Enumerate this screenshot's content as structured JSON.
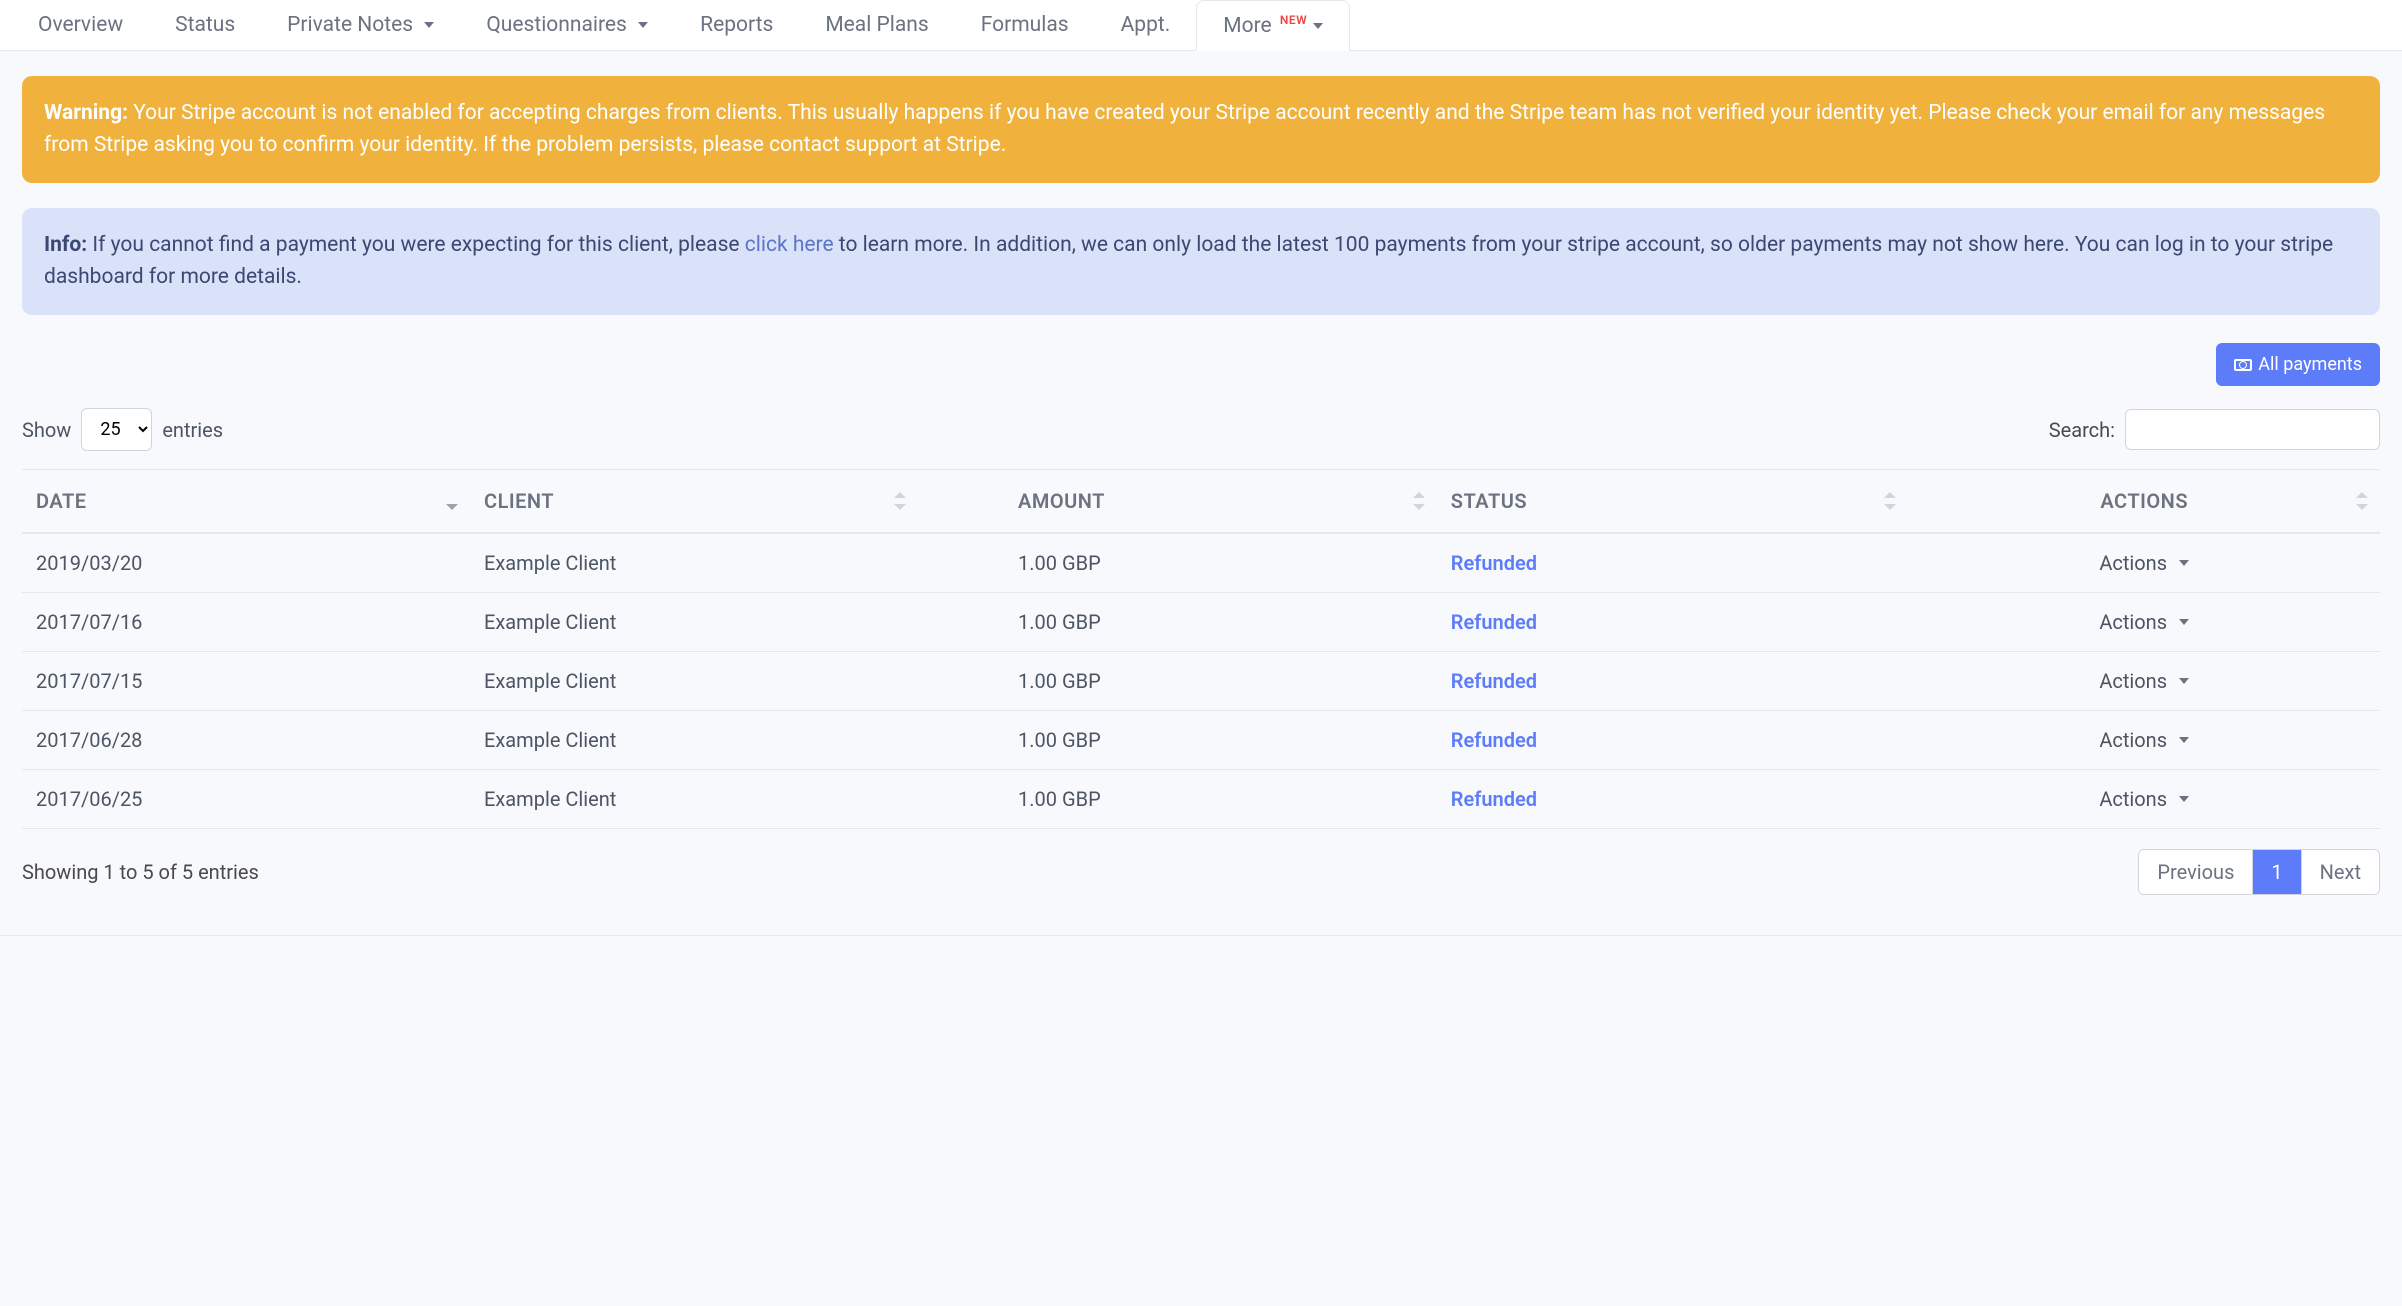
{
  "nav": {
    "items": [
      {
        "label": "Overview",
        "dropdown": false
      },
      {
        "label": "Status",
        "dropdown": false
      },
      {
        "label": "Private Notes",
        "dropdown": true
      },
      {
        "label": "Questionnaires",
        "dropdown": true
      },
      {
        "label": "Reports",
        "dropdown": false
      },
      {
        "label": "Meal Plans",
        "dropdown": false
      },
      {
        "label": "Formulas",
        "dropdown": false
      },
      {
        "label": "Appt.",
        "dropdown": false
      }
    ],
    "more_label": "More",
    "more_badge": "NEW"
  },
  "warning": {
    "title": "Warning:",
    "text": "Your Stripe account is not enabled for accepting charges from clients. This usually happens if you have created your Stripe account recently and the Stripe team has not verified your identity yet. Please check your email for any messages from Stripe asking you to confirm your identity. If the problem persists, please contact support at Stripe."
  },
  "info": {
    "title": "Info:",
    "text_before": "If you cannot find a payment you were expecting for this client, please ",
    "link_text": "click here",
    "text_after": " to learn more. In addition, we can only load the latest 100 payments from your stripe account, so older payments may not show here. You can log in to your stripe dashboard for more details."
  },
  "all_payments_btn": "All payments",
  "show_label": "Show",
  "entries_label": "entries",
  "per_page_selected": "25",
  "search_label": "Search:",
  "table": {
    "headers": {
      "date": "DATE",
      "client": "CLIENT",
      "amount": "AMOUNT",
      "status": "STATUS",
      "actions": "ACTIONS"
    },
    "rows": [
      {
        "date": "2019/03/20",
        "client": "Example Client",
        "amount": "1.00 GBP",
        "status": "Refunded",
        "actions": "Actions"
      },
      {
        "date": "2017/07/16",
        "client": "Example Client",
        "amount": "1.00 GBP",
        "status": "Refunded",
        "actions": "Actions"
      },
      {
        "date": "2017/07/15",
        "client": "Example Client",
        "amount": "1.00 GBP",
        "status": "Refunded",
        "actions": "Actions"
      },
      {
        "date": "2017/06/28",
        "client": "Example Client",
        "amount": "1.00 GBP",
        "status": "Refunded",
        "actions": "Actions"
      },
      {
        "date": "2017/06/25",
        "client": "Example Client",
        "amount": "1.00 GBP",
        "status": "Refunded",
        "actions": "Actions"
      }
    ]
  },
  "showing_text": "Showing 1 to 5 of 5 entries",
  "pagination": {
    "prev": "Previous",
    "pages": [
      "1"
    ],
    "next": "Next"
  }
}
